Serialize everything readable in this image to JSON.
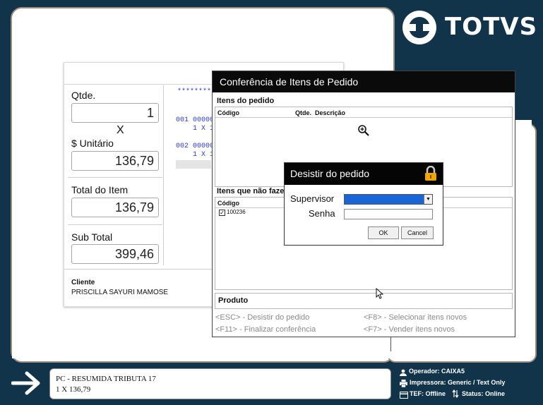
{
  "brand": {
    "logo_text": "TOTVS"
  },
  "sale": {
    "qtde_label": "Qtde.",
    "qtde_value": "1",
    "times": "X",
    "unit_label": "$ Unitário",
    "unit_value": "136,79",
    "total_item_label": "Total do Item",
    "total_item_value": "136,79",
    "subtotal_label": "Sub Total",
    "subtotal_value": "399,46",
    "cliente_label": "Cliente",
    "cliente_value": "PRISCILLA SAYURI MAMOSE",
    "receipt_stars": "********",
    "receipt_lines": [
      "001 00000",
      "1 X 1",
      "002 00000",
      "1 X 1"
    ]
  },
  "conferencia": {
    "title": "Conferência de Itens de Pedido",
    "itens_pedido_label": "Itens do pedido",
    "columns": [
      "Código",
      "Qtde.",
      "Descrição"
    ],
    "itens_nao_label": "Itens que não faze",
    "nao_columns": [
      "Código"
    ],
    "nao_rows": [
      {
        "codigo": "100236",
        "checked": true
      }
    ],
    "produto_label": "Produto",
    "shortcuts": [
      "<ESC> - Desistir do pedido",
      "<F8> - Selecionar itens novos",
      "<F11> - Finalizar conferência",
      "<F7> - Vender itens novos"
    ]
  },
  "desistir": {
    "title": "Desistir do pedido",
    "supervisor_label": "Supervisor",
    "supervisor_value": "",
    "senha_label": "Senha",
    "senha_value": "",
    "ok_label": "OK",
    "cancel_label": "Cancel"
  },
  "footer": {
    "message_line1": "PC - RESUMIDA TRIBUTA 17",
    "message_line2": "1 X 136,79",
    "operador": "Operador: CAIXA5",
    "impressora": "Impressora: Generic / Text Only",
    "tef": "TEF: Offline",
    "status": "Status: Online"
  },
  "colors": {
    "background": "#11344a",
    "selection": "#1a64d8",
    "shortcut_text": "#8a8a8a"
  }
}
